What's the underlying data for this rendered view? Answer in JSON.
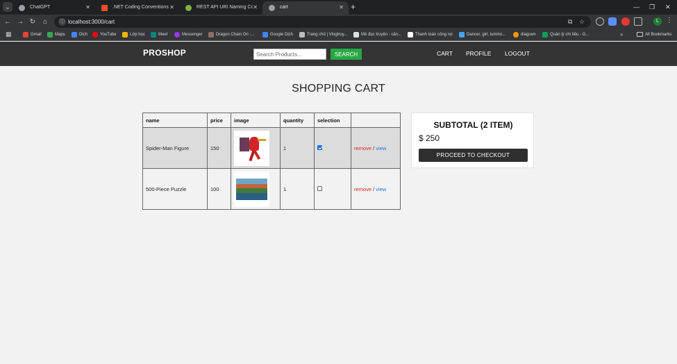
{
  "browser": {
    "tabs": [
      {
        "title": "ChatGPT",
        "favicon_color": "#9aa0a6",
        "active": false
      },
      {
        "title": ".NET Coding Conventions - C#",
        "favicon_color": "#f25022",
        "active": false
      },
      {
        "title": "REST API URI Naming Conventi",
        "favicon_color": "#7cb342",
        "active": false
      },
      {
        "title": "cart",
        "favicon_color": "#9aa0a6",
        "active": true
      }
    ],
    "url": "localhost:3000/cart",
    "profile_initial": "L",
    "bookmarks": [
      {
        "label": "Gmail",
        "color": "#ea4335"
      },
      {
        "label": "Maps",
        "color": "#34a853"
      },
      {
        "label": "Dich",
        "color": "#4285f4"
      },
      {
        "label": "YouTube",
        "color": "#ff0000"
      },
      {
        "label": "Lớp học",
        "color": "#f4b400"
      },
      {
        "label": "Meet",
        "color": "#00897b"
      },
      {
        "label": "Messenger",
        "color": "#a033ff"
      },
      {
        "label": "Dragon Chain Ori :...",
        "color": "#8d6e63"
      },
      {
        "label": "Google Dịch",
        "color": "#4285f4"
      },
      {
        "label": "Trang chủ | Vlogtruy...",
        "color": "#bdbdbd"
      },
      {
        "label": "Mê đọc truyện - căn...",
        "color": "#e0e0e0"
      },
      {
        "label": "Thanh toán công nợ",
        "color": "#ffffff"
      },
      {
        "label": "Dancer, girl, lumino...",
        "color": "#42a5f5"
      },
      {
        "label": "diagram",
        "color": "#ff9800"
      },
      {
        "label": "Quản lý chi tiêu - G...",
        "color": "#0f9d58"
      }
    ],
    "all_bookmarks_label": "All Bookmarks"
  },
  "navbar": {
    "brand": "PROSHOP",
    "search_placeholder": "Search Products...",
    "search_button": "SEARCH",
    "links": {
      "cart": "CART",
      "profile": "PROFILE",
      "logout": "LOGOUT"
    }
  },
  "page": {
    "title": "SHOPPING CART"
  },
  "cart": {
    "headers": {
      "name": "name",
      "price": "price",
      "image": "image",
      "quantity": "quantity",
      "selection": "selection",
      "actions": ""
    },
    "rows": [
      {
        "name": "Spider-Man Figure",
        "price": "150",
        "quantity": "1",
        "selected": true,
        "remove_label": "remove",
        "separator": "/",
        "view_label": "view",
        "image_subject": "spider-man-figure"
      },
      {
        "name": "500-Piece Puzzle",
        "price": "100",
        "quantity": "1",
        "selected": false,
        "remove_label": "remove",
        "separator": "/",
        "view_label": "view",
        "image_subject": "puzzle-landscape"
      }
    ]
  },
  "summary": {
    "title": "SUBTOTAL (2 ITEM)",
    "total": "$ 250",
    "checkout_button": "PROCEED TO CHECKOUT"
  }
}
